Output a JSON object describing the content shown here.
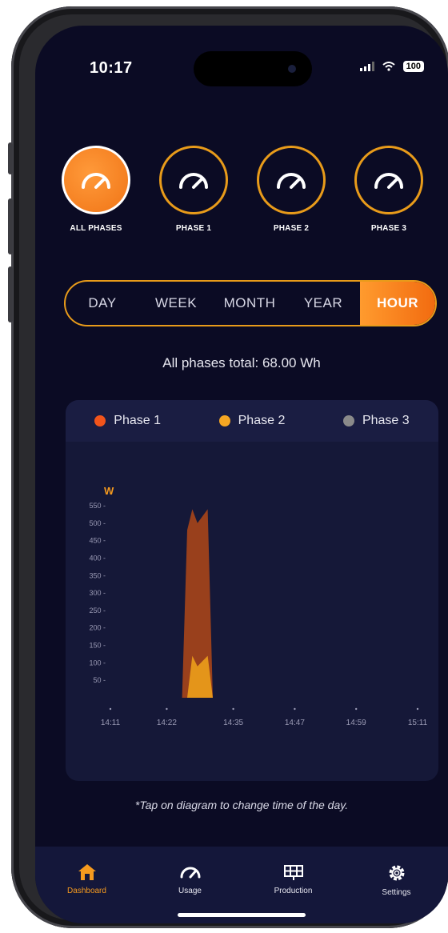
{
  "status_bar": {
    "time": "10:17",
    "battery": "100",
    "signal": "signal-icon",
    "wifi": "wifi-icon"
  },
  "phase_selector": [
    {
      "label": "ALL PHASES",
      "icon": "gauge-icon",
      "active": true
    },
    {
      "label": "PHASE 1",
      "icon": "gauge-icon",
      "active": false
    },
    {
      "label": "PHASE 2",
      "icon": "gauge-icon",
      "active": false
    },
    {
      "label": "PHASE 3",
      "icon": "gauge-icon",
      "active": false
    }
  ],
  "time_range": {
    "options": [
      "DAY",
      "WEEK",
      "MONTH",
      "YEAR",
      "HOUR"
    ],
    "selected": "HOUR"
  },
  "total_text": "All phases total: 68.00 Wh",
  "legend": [
    {
      "name": "Phase 1",
      "color": "#f2541b"
    },
    {
      "name": "Phase 2",
      "color": "#f5a623"
    },
    {
      "name": "Phase 3",
      "color": "#8a8a8a"
    }
  ],
  "chart_data": {
    "type": "area",
    "unit_label": "W",
    "ylim": [
      0,
      550
    ],
    "y_ticks": [
      50,
      100,
      150,
      200,
      250,
      300,
      350,
      400,
      450,
      500,
      550
    ],
    "x_ticks": [
      "14:11",
      "14:22",
      "14:35",
      "14:47",
      "14:59",
      "15:11"
    ],
    "xlim": [
      "14:11",
      "15:11"
    ],
    "series": [
      {
        "name": "Phase 1",
        "color": "#a0421a",
        "points": [
          [
            "14:25",
            0
          ],
          [
            "14:26",
            480
          ],
          [
            "14:27",
            540
          ],
          [
            "14:28",
            500
          ],
          [
            "14:30",
            540
          ],
          [
            "14:31",
            0
          ]
        ]
      },
      {
        "name": "Phase 2",
        "color": "#e89a1a",
        "points": [
          [
            "14:26",
            0
          ],
          [
            "14:27",
            120
          ],
          [
            "14:28",
            90
          ],
          [
            "14:30",
            120
          ],
          [
            "14:31",
            0
          ]
        ]
      }
    ],
    "grid": false
  },
  "hint": "*Tap on diagram to change time of the day.",
  "tabbar": [
    {
      "label": "Dashboard",
      "icon": "home-icon",
      "active": true
    },
    {
      "label": "Usage",
      "icon": "gauge-icon",
      "active": false
    },
    {
      "label": "Production",
      "icon": "solar-panel-icon",
      "active": false
    },
    {
      "label": "Settings",
      "icon": "gear-icon",
      "active": false
    }
  ],
  "colors": {
    "accent": "#f7931e",
    "background": "#0b0b24",
    "card": "#151838"
  }
}
